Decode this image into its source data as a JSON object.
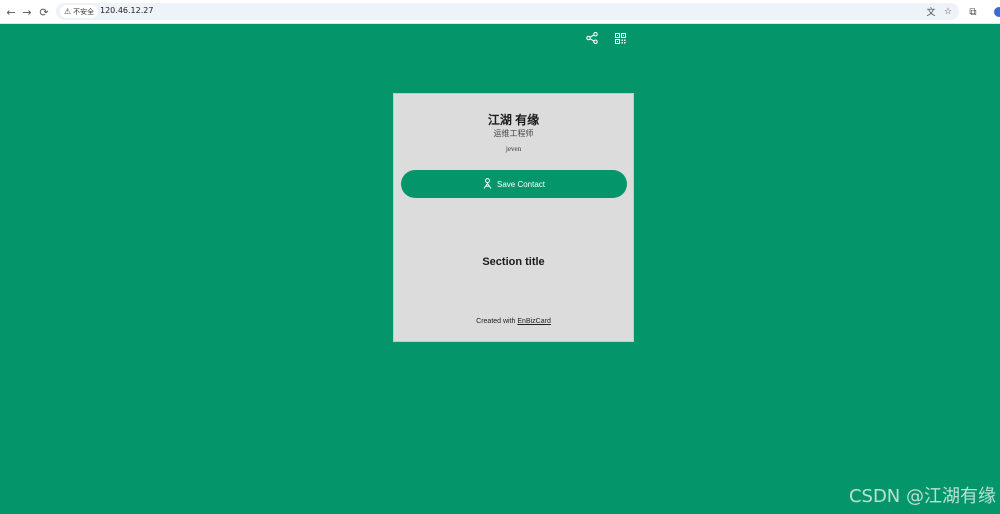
{
  "browser": {
    "back_glyph": "←",
    "forward_glyph": "→",
    "reload_glyph": "⟳",
    "security_label": "不安全",
    "url": "120.46.12.27",
    "translate_glyph": "文",
    "star_glyph": "☆",
    "extensions_glyph": "⧉"
  },
  "card": {
    "name": "江湖 有缘",
    "role": "运维工程师",
    "company": "jeven",
    "save_label": "Save Contact",
    "section_title": "Section title",
    "footer_prefix": "Created with",
    "footer_link": "EnBizCard"
  },
  "watermark": "CSDN @江湖有缘",
  "colors": {
    "page_background": "#04966a",
    "card_background": "#dcdcdc",
    "button_background": "#04966a"
  },
  "icons": {
    "share": "share-icon",
    "qr": "qr-code-icon",
    "contact": "contact-icon",
    "warning": "warning-icon"
  }
}
